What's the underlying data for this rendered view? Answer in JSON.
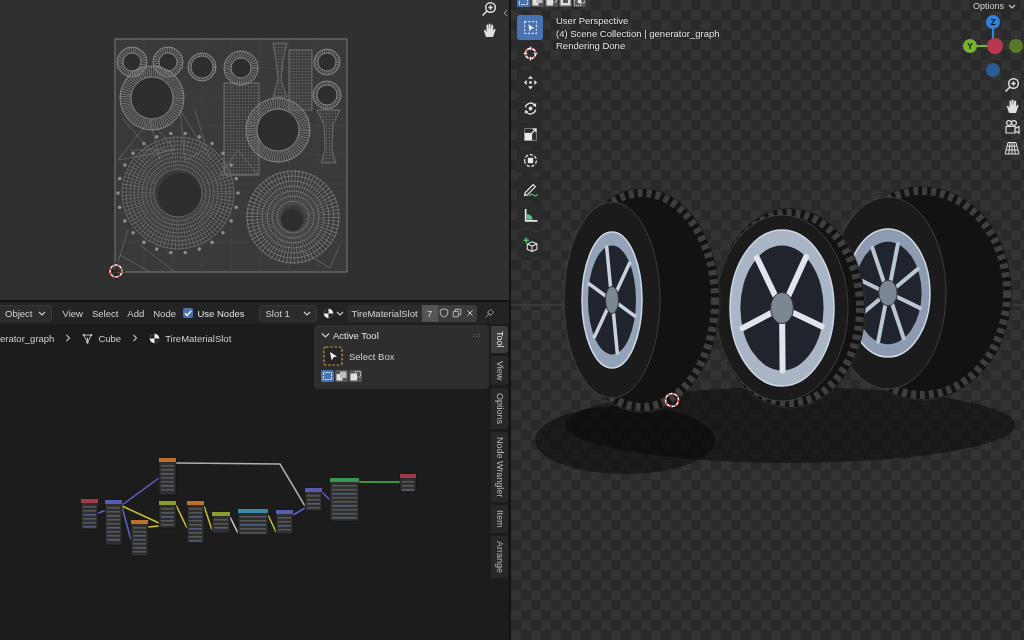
{
  "node_editor": {
    "header": {
      "mode": "Object",
      "menus": [
        "View",
        "Select",
        "Add",
        "Node"
      ],
      "use_nodes": {
        "label": "Use Nodes",
        "checked": true
      },
      "slot": "Slot 1",
      "material": "TireMaterialSlot",
      "users": "7"
    },
    "breadcrumbs": [
      {
        "kind": "plain",
        "label": "erator_graph"
      },
      {
        "kind": "mesh",
        "label": "Cube"
      },
      {
        "kind": "material",
        "label": "TireMaterialSlot"
      }
    ],
    "active_tool": {
      "title": "Active Tool",
      "expanded": true,
      "tool": "Select Box",
      "modes": [
        {
          "kind": "set",
          "selected": true
        },
        {
          "kind": "extend",
          "selected": false
        },
        {
          "kind": "subtract",
          "selected": false
        }
      ]
    },
    "node_graph": {
      "nodes": [
        {
          "color": "#a33a4c"
        },
        {
          "color": "#5a5ab0"
        },
        {
          "color": "#c0702c"
        },
        {
          "color": "#8c9c2e"
        },
        {
          "color": "#c0702c"
        },
        {
          "color": "#c0702c"
        },
        {
          "color": "#8c9c2e"
        },
        {
          "color": "#3a8aa8"
        },
        {
          "color": "#5a5ab0"
        },
        {
          "color": "#5a5ab0"
        },
        {
          "color": "#3a9650"
        },
        {
          "color": "#a33a4c"
        }
      ]
    },
    "sidebar_tabs": [
      {
        "label": "Tool",
        "selected": true
      },
      {
        "label": "View",
        "selected": false
      },
      {
        "label": "Options",
        "selected": false
      },
      {
        "label": "Node Wrangler",
        "selected": false
      },
      {
        "label": "Item",
        "selected": false
      },
      {
        "label": "Arrange",
        "selected": false
      }
    ]
  },
  "viewport": {
    "header": {
      "select_modes": [
        {
          "kind": "set",
          "selected": true
        },
        {
          "kind": "extend",
          "selected": false
        },
        {
          "kind": "subtract",
          "selected": false
        },
        {
          "kind": "invert",
          "selected": false
        },
        {
          "kind": "intersect",
          "selected": false
        }
      ],
      "options": "Options"
    },
    "info": [
      "User Perspective",
      "(4) Scene Collection | generator_graph",
      "Rendering Done"
    ],
    "toolbar": [
      {
        "kind": "select_box",
        "selected": true
      },
      {
        "kind": "cursor",
        "selected": false
      },
      {
        "kind": "move",
        "selected": false
      },
      {
        "kind": "rotate",
        "selected": false
      },
      {
        "kind": "scale",
        "selected": false
      },
      {
        "kind": "transform",
        "selected": false
      },
      {
        "kind": "annotate",
        "selected": false
      },
      {
        "kind": "measure",
        "selected": false
      },
      {
        "kind": "add_cube",
        "selected": false
      }
    ],
    "gizmo": {
      "axes": [
        {
          "label": "Z",
          "color": "#2f83e3"
        },
        {
          "label": "Y",
          "color": "#7ab32e"
        },
        {
          "color": "#b8394f"
        },
        {
          "color": "#58792a"
        },
        {
          "color": "#2b5b94"
        }
      ]
    }
  }
}
